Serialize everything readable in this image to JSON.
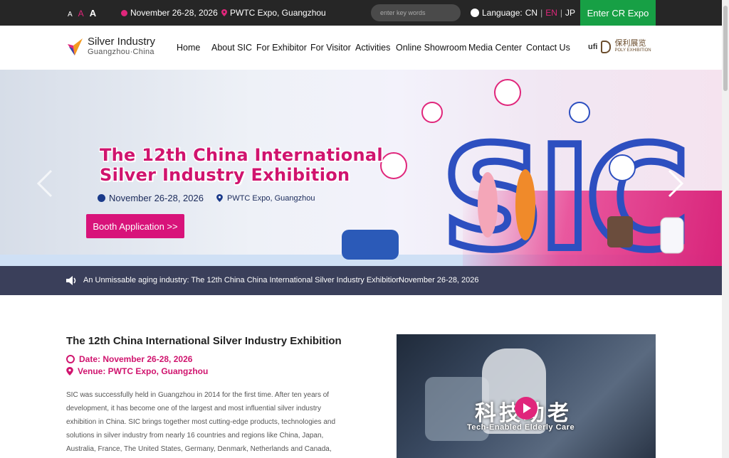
{
  "topbar": {
    "font_sizes": [
      "A",
      "A",
      "A"
    ],
    "date": "November 26-28, 2026",
    "venue": "PWTC Expo, Guangzhou",
    "search_placeholder": "enter key words",
    "language_label": "Language:",
    "languages": [
      "CN",
      "EN",
      "JP"
    ],
    "language_sep": "|",
    "enter_button": "Enter CR Expo"
  },
  "nav": {
    "logo_line1": "Silver Industry",
    "logo_line2": "Guangzhou·China",
    "items": [
      "Home",
      "About SIC",
      "For Exhibitor",
      "For Visitor",
      "Activities",
      "Online Showroom",
      "Media Center",
      "Contact Us"
    ],
    "partner_ufi": "ufi",
    "partner_cn": "保利展览",
    "partner_en": "POLY EXHIBITION"
  },
  "hero": {
    "title_line1": "The 12th China International",
    "title_line2": "Silver Industry Exhibition",
    "date": "November 26-28, 2026",
    "venue": "PWTC Expo, Guangzhou",
    "booth_button": "Booth Application  >>",
    "sic_text": "SIC"
  },
  "ticker": {
    "text": "An Unmissable aging industry: The 12th China China International Silver Industry Exhibition",
    "date": "November 26-28, 2026"
  },
  "intro": {
    "title": "The 12th China International Silver Industry Exhibition",
    "date_line": "Date: November 26-28, 2026",
    "venue_line": "Venue: PWTC Expo, Guangzhou",
    "description": "SIC was successfully held in Guangzhou in 2014 for the first time. After ten years of development, it has become one of the largest and most influential silver industry exhibition in China. SIC brings together most cutting-edge products, technologies and solutions in silver industry from nearly 16 countries and regions like China, Japan, Australia, France, The United States, Germany, Denmark, Netherlands and Canada,"
  },
  "video": {
    "caption_cn": "科技助老",
    "caption_en": "Tech-Enabled Elderly Care"
  },
  "colors": {
    "accent": "#d0146e",
    "topbar": "#262626",
    "enter_button": "#17a045",
    "ticker": "#3a3f5a"
  }
}
